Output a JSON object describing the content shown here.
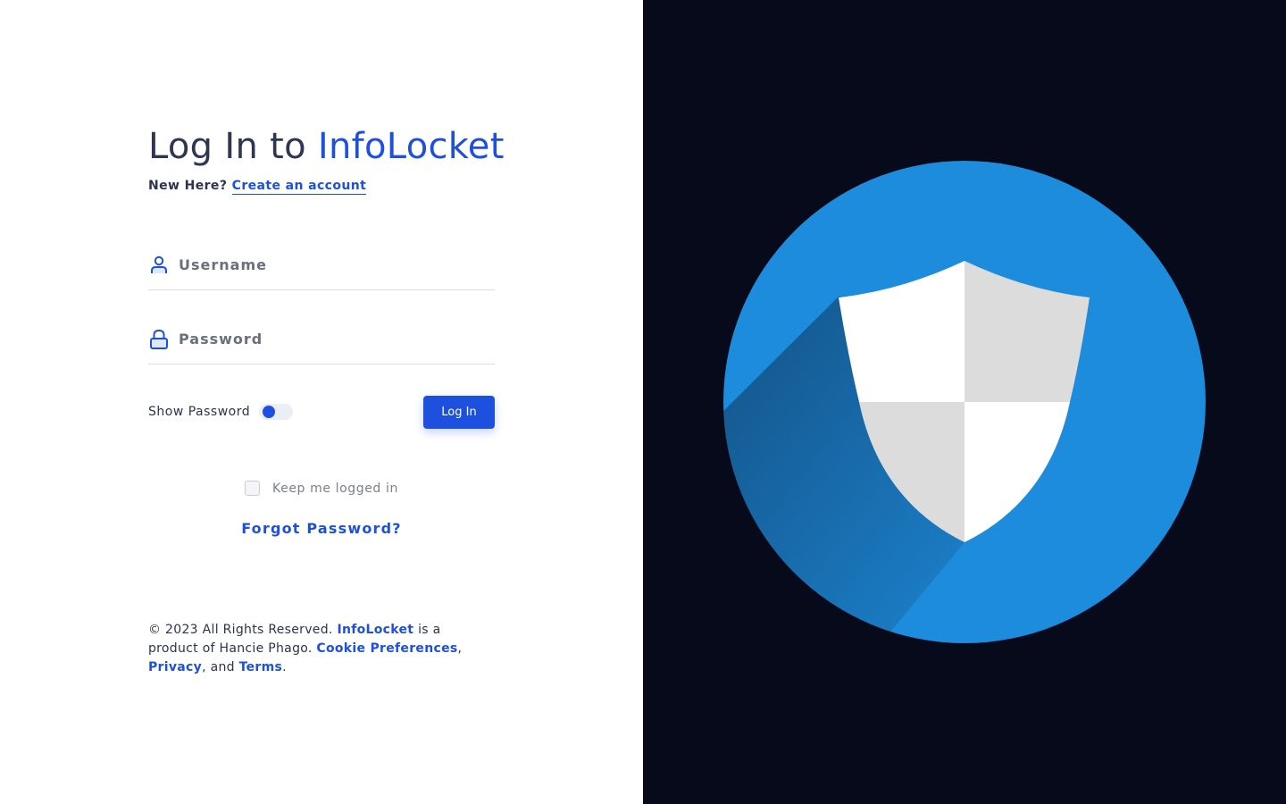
{
  "header": {
    "title_prefix": "Log In to",
    "brand": "InfoLocket"
  },
  "signup": {
    "prompt": "New Here?",
    "link": "Create an account"
  },
  "form": {
    "username_placeholder": "Username",
    "password_placeholder": "Password",
    "show_password_label": "Show Password",
    "show_password_on": false,
    "login_button": "Log In",
    "keep_logged_in": "Keep me logged in",
    "forgot_password": "Forgot Password?"
  },
  "footer": {
    "copyright": "© 2023 All Rights Reserved.",
    "brand_link": "InfoLocket",
    "product_text": "is a product of Hancie Phago.",
    "cookie_link": "Cookie Preferences",
    "privacy_link": "Privacy",
    "and_text": ", and",
    "terms_link": "Terms",
    "period": "."
  },
  "colors": {
    "accent": "#1e50e0",
    "panel_bg": "#070a1a",
    "shield_circle": "#1e8cdc",
    "shield_white": "#ffffff",
    "shield_grey": "#dcdcdc"
  },
  "illustration": {
    "icon": "shield-icon"
  }
}
